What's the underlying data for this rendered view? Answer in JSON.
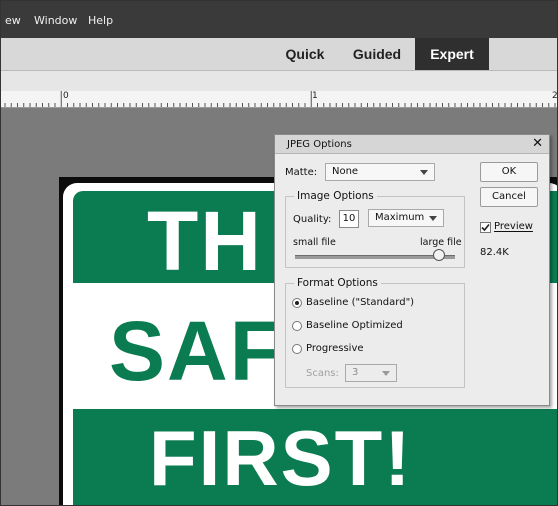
{
  "menu": {
    "items": [
      "ew",
      "Window",
      "Help"
    ]
  },
  "modes": {
    "quick": "Quick",
    "guided": "Guided",
    "expert": "Expert"
  },
  "ruler": {
    "labels": [
      "0",
      "1",
      "2"
    ]
  },
  "sign": {
    "line1": "TH",
    "line2": "SAF",
    "line3": "FIRST!"
  },
  "dialog": {
    "title": "JPEG Options",
    "close": "✕",
    "matte_label": "Matte:",
    "matte_value": "None",
    "ok": "OK",
    "cancel": "Cancel",
    "preview_label": "Preview",
    "preview_checked": true,
    "file_size": "82.4K",
    "image_options": {
      "title": "Image Options",
      "quality_label": "Quality:",
      "quality_value": "10",
      "quality_preset": "Maximum",
      "small_file": "small file",
      "large_file": "large file",
      "slider_level": 0.9
    },
    "format_options": {
      "title": "Format Options",
      "baseline_standard": "Baseline (\"Standard\")",
      "baseline_optimized": "Baseline Optimized",
      "progressive": "Progressive",
      "scans_label": "Scans:",
      "scans_value": "3",
      "selected": "baseline_standard"
    }
  }
}
